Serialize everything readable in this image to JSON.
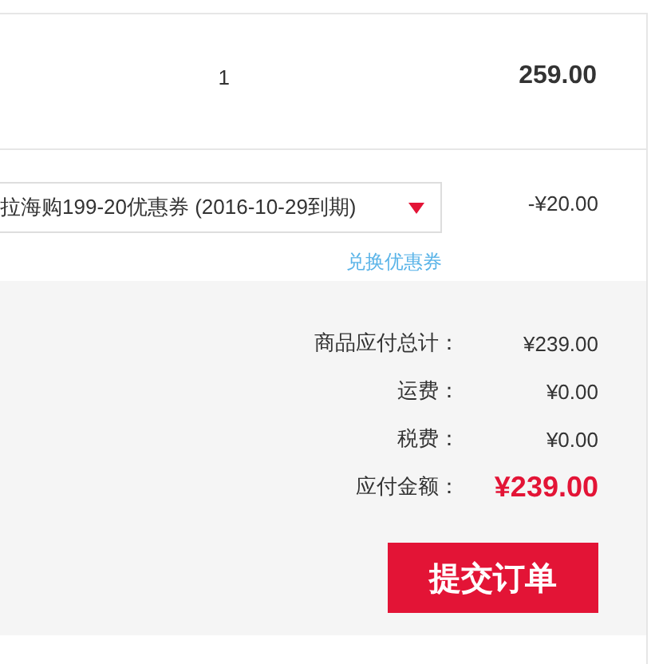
{
  "item_row": {
    "quantity": "1",
    "subtotal": "259.00"
  },
  "coupon": {
    "selected_text": "拉海购199-20优惠券  (2016-10-29到期)",
    "discount": "-¥20.00",
    "exchange_link": "兑换优惠券"
  },
  "summary": [
    {
      "label": "商品应付总计：",
      "value": "¥239.00",
      "kind": "normal"
    },
    {
      "label": "运费：",
      "value": "¥0.00",
      "kind": "normal"
    },
    {
      "label": "税费：",
      "value": "¥0.00",
      "kind": "normal"
    },
    {
      "label": "应付金额：",
      "value": "¥239.00",
      "kind": "total"
    }
  ],
  "submit_button": "提交订单"
}
